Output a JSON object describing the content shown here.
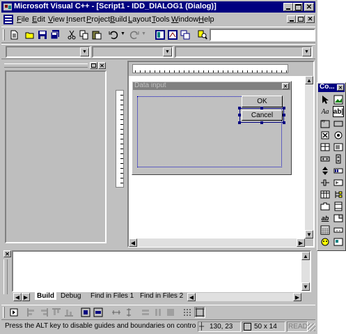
{
  "window": {
    "title": "Microsoft Visual C++ - [Script1 - IDD_DIALOG1 (Dialog)]"
  },
  "menu": {
    "file": "File",
    "edit": "Edit",
    "view": "View",
    "insert": "Insert",
    "project": "Project",
    "build": "Build",
    "layout": "Layout",
    "tools": "Tools",
    "window": "Window",
    "help": "Help"
  },
  "dialog": {
    "title": "Data input",
    "ok_label": "OK",
    "cancel_label": "Cancel"
  },
  "controls_palette": {
    "title": "Co..."
  },
  "output": {
    "tabs": [
      "Build",
      "Debug",
      "Find in Files 1",
      "Find in Files 2"
    ]
  },
  "status": {
    "message": "Press the ALT key to disable guides and boundaries on control placemen",
    "position": "130, 23",
    "size": "50 x 14",
    "mode": "READ"
  },
  "colors": {
    "titlebar": "#000080",
    "desktop": "#808080",
    "selection": "#000080"
  }
}
